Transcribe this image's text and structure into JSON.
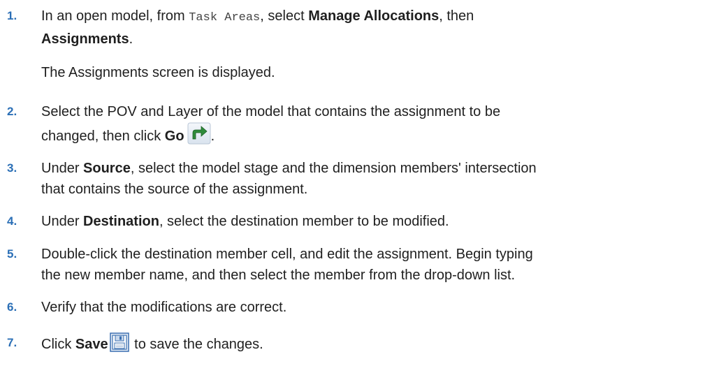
{
  "steps": [
    {
      "num": "1.",
      "t1": "In an open model, from ",
      "code": "Task Areas",
      "t2": ", select ",
      "b1": "Manage Allocations",
      "t3": ", then",
      "b2": "Assignments",
      "t4": ".",
      "result": "The Assignments screen is displayed."
    },
    {
      "num": "2.",
      "t1": "Select the POV and Layer of the model that contains the assignment to be",
      "t2": "changed, then click ",
      "b1": "Go",
      "t3": ".",
      "icon": "go-arrow-icon"
    },
    {
      "num": "3.",
      "t1": "Under ",
      "b1": "Source",
      "t2": ", select the model stage and the dimension members' intersection",
      "t3": "that contains the source of the assignment."
    },
    {
      "num": "4.",
      "t1": "Under ",
      "b1": "Destination",
      "t2": ", select the destination member to be modified."
    },
    {
      "num": "5.",
      "t1": "Double-click the destination member cell, and edit the assignment. Begin typing",
      "t2": "the new member name, and then select the member from the drop-down list."
    },
    {
      "num": "6.",
      "t1": "Verify that the modifications are correct."
    },
    {
      "num": "7.",
      "t1": "Click ",
      "b1": "Save",
      "t2": " to save the changes.",
      "icon": "save-disk-icon"
    }
  ],
  "colors": {
    "step_number": "#2b6fb6",
    "body_text": "#1f1f1f",
    "go_icon": "#2e8b3a",
    "save_icon": "#3a6fb0"
  }
}
